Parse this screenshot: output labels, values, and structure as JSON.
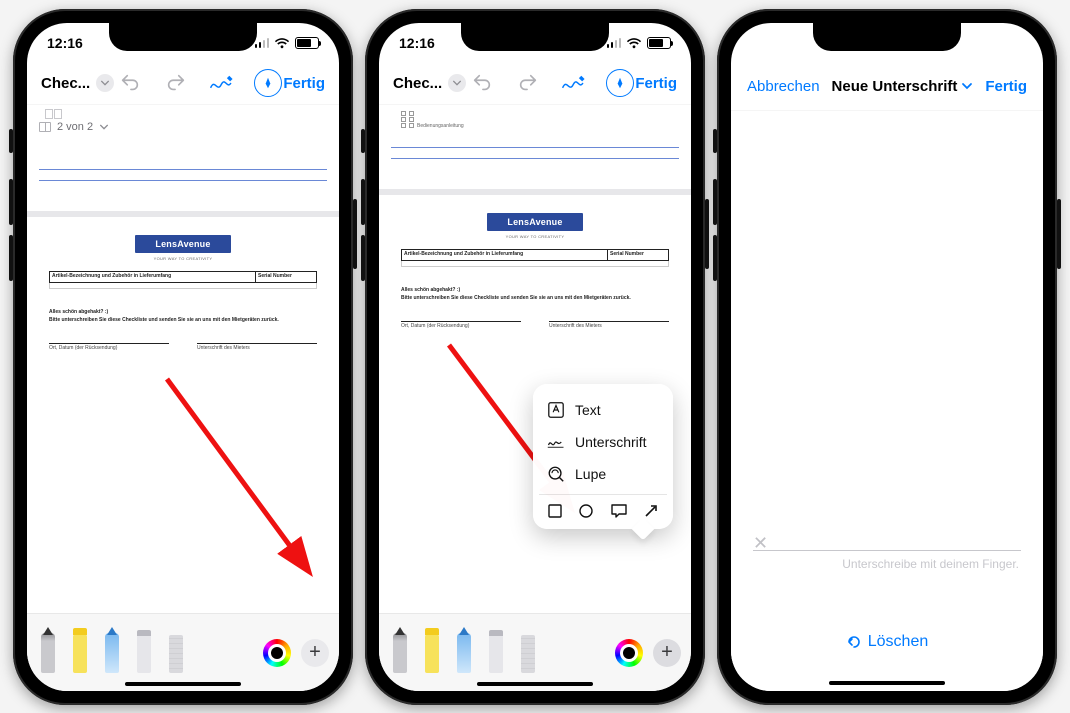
{
  "status": {
    "time": "12:16"
  },
  "nav": {
    "title": "Chec...",
    "done": "Fertig"
  },
  "thumbs": {
    "counter": "2 von 2"
  },
  "document": {
    "brand": "LensAvenue",
    "tagline": "YOUR WAY TO CREATIVITY",
    "table": {
      "col1": "Artikel-Bezeichnung und Zubehör in Lieferumfang",
      "col2": "Serial Number"
    },
    "question1": "Alles schön abgehakt? :)",
    "question2": "Bitte unterschreiben Sie diese Checkliste und senden Sie sie an uns mit den Mietgeräten zurück.",
    "sigleft": "Ort, Datum (der Rücksendung)",
    "sigright": "Unterschrift des Mieters",
    "chkrow": "Bedienungsanleitung"
  },
  "popover": {
    "text": "Text",
    "signature": "Unterschrift",
    "loupe": "Lupe"
  },
  "signature": {
    "cancel": "Abbrechen",
    "title": "Neue Unterschrift",
    "done": "Fertig",
    "hint": "Unterschreibe mit deinem Finger.",
    "clear": "Löschen"
  },
  "icons": {
    "undo": "undo-icon",
    "redo": "redo-icon",
    "markup": "markup-icon",
    "pentip": "pentip-icon"
  }
}
